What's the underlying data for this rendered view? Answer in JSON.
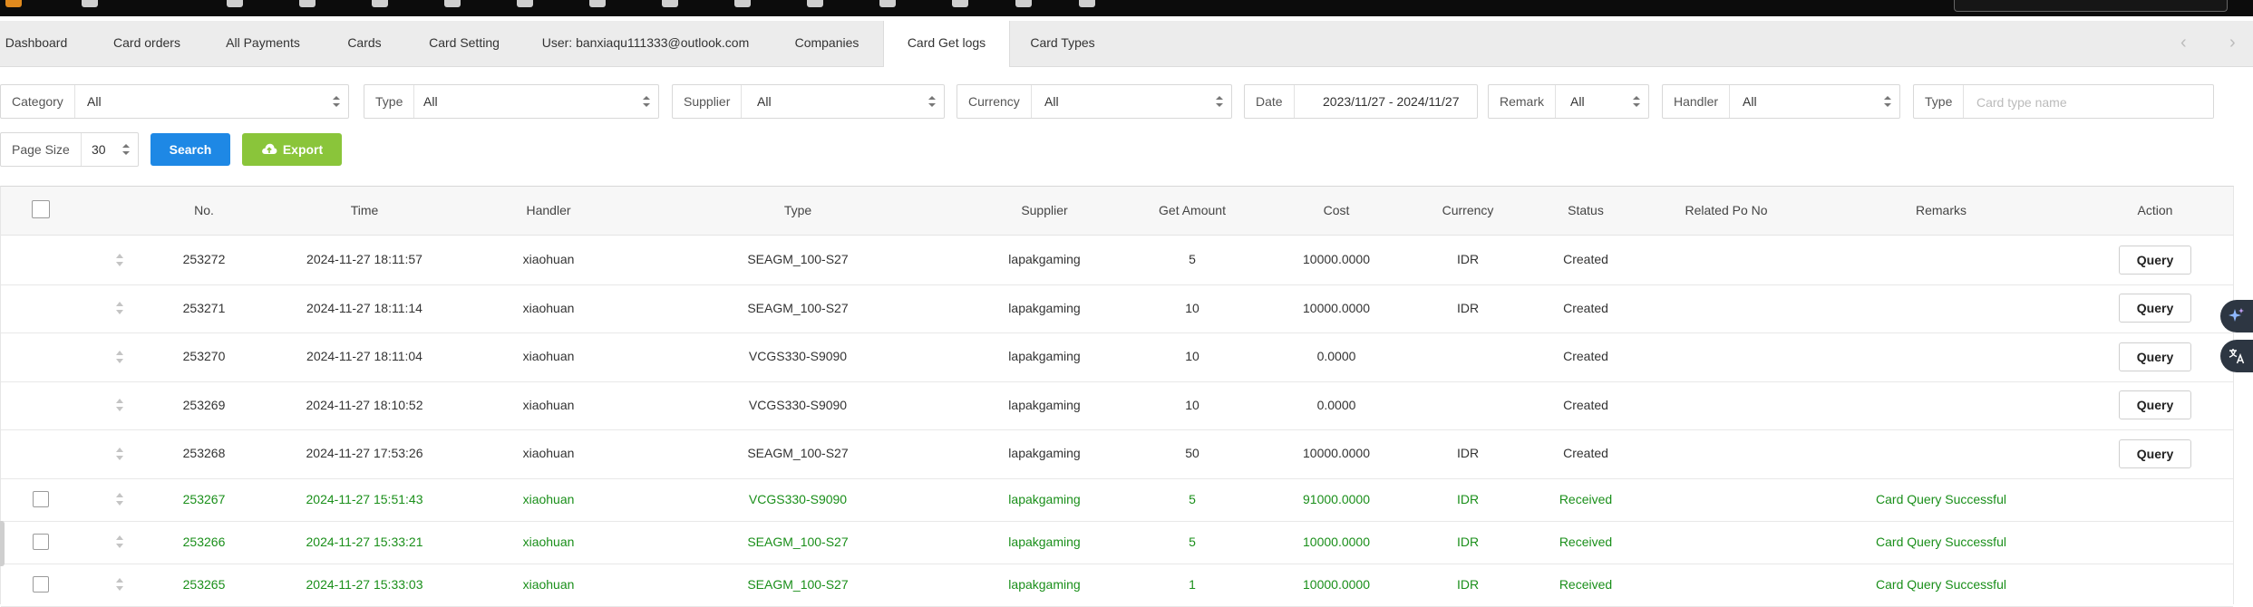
{
  "tabs": [
    {
      "label": "Dashboard",
      "active": false
    },
    {
      "label": "Card orders",
      "active": false
    },
    {
      "label": "All Payments",
      "active": false
    },
    {
      "label": "Cards",
      "active": false
    },
    {
      "label": "Card Setting",
      "active": false
    },
    {
      "label": "User: banxiaqu111333@outlook.com",
      "active": false
    },
    {
      "label": "Companies",
      "active": false
    },
    {
      "label": "Card Get logs",
      "active": true
    },
    {
      "label": "Card Types",
      "active": false
    }
  ],
  "tab_nav": {
    "prev": "‹",
    "next": "›"
  },
  "filters": {
    "category": {
      "label": "Category",
      "value": "All"
    },
    "type": {
      "label": "Type",
      "value": "All"
    },
    "supplier": {
      "label": "Supplier",
      "value": "All"
    },
    "currency": {
      "label": "Currency",
      "value": "All"
    },
    "date": {
      "label": "Date",
      "value": "2023/11/27 - 2024/11/27"
    },
    "remark": {
      "label": "Remark",
      "value": "All"
    },
    "handler": {
      "label": "Handler",
      "value": "All"
    },
    "card_type": {
      "label": "Type",
      "value": "",
      "placeholder": "Card type name"
    },
    "page_size": {
      "label": "Page Size",
      "value": "30"
    }
  },
  "buttons": {
    "search": "Search",
    "export": "Export"
  },
  "table": {
    "columns": [
      "No.",
      "Time",
      "Handler",
      "Type",
      "Supplier",
      "Get Amount",
      "Cost",
      "Currency",
      "Status",
      "Related Po No",
      "Remarks",
      "Action"
    ],
    "rows": [
      {
        "no": "253272",
        "time": "2024-11-27 18:11:57",
        "handler": "xiaohuan",
        "type": "SEAGM_100-S27",
        "supplier": "lapakgaming",
        "amount": "5",
        "cost": "10000.0000",
        "currency": "IDR",
        "status": "Created",
        "po": "",
        "remarks": "",
        "action": "Query",
        "checkbox": false,
        "received": false
      },
      {
        "no": "253271",
        "time": "2024-11-27 18:11:14",
        "handler": "xiaohuan",
        "type": "SEAGM_100-S27",
        "supplier": "lapakgaming",
        "amount": "10",
        "cost": "10000.0000",
        "currency": "IDR",
        "status": "Created",
        "po": "",
        "remarks": "",
        "action": "Query",
        "checkbox": false,
        "received": false
      },
      {
        "no": "253270",
        "time": "2024-11-27 18:11:04",
        "handler": "xiaohuan",
        "type": "VCGS330-S9090",
        "supplier": "lapakgaming",
        "amount": "10",
        "cost": "0.0000",
        "currency": "",
        "status": "Created",
        "po": "",
        "remarks": "",
        "action": "Query",
        "checkbox": false,
        "received": false
      },
      {
        "no": "253269",
        "time": "2024-11-27 18:10:52",
        "handler": "xiaohuan",
        "type": "VCGS330-S9090",
        "supplier": "lapakgaming",
        "amount": "10",
        "cost": "0.0000",
        "currency": "",
        "status": "Created",
        "po": "",
        "remarks": "",
        "action": "Query",
        "checkbox": false,
        "received": false
      },
      {
        "no": "253268",
        "time": "2024-11-27 17:53:26",
        "handler": "xiaohuan",
        "type": "SEAGM_100-S27",
        "supplier": "lapakgaming",
        "amount": "50",
        "cost": "10000.0000",
        "currency": "IDR",
        "status": "Created",
        "po": "",
        "remarks": "",
        "action": "Query",
        "checkbox": false,
        "received": false
      },
      {
        "no": "253267",
        "time": "2024-11-27 15:51:43",
        "handler": "xiaohuan",
        "type": "VCGS330-S9090",
        "supplier": "lapakgaming",
        "amount": "5",
        "cost": "91000.0000",
        "currency": "IDR",
        "status": "Received",
        "po": "",
        "remarks": "Card Query Successful",
        "action": "",
        "checkbox": true,
        "received": true
      },
      {
        "no": "253266",
        "time": "2024-11-27 15:33:21",
        "handler": "xiaohuan",
        "type": "SEAGM_100-S27",
        "supplier": "lapakgaming",
        "amount": "5",
        "cost": "10000.0000",
        "currency": "IDR",
        "status": "Received",
        "po": "",
        "remarks": "Card Query Successful",
        "action": "",
        "checkbox": true,
        "received": true
      },
      {
        "no": "253265",
        "time": "2024-11-27 15:33:03",
        "handler": "xiaohuan",
        "type": "SEAGM_100-S27",
        "supplier": "lapakgaming",
        "amount": "1",
        "cost": "10000.0000",
        "currency": "IDR",
        "status": "Received",
        "po": "",
        "remarks": "Card Query Successful",
        "action": "",
        "checkbox": true,
        "received": true
      }
    ]
  },
  "colors": {
    "primary": "#1e88e5",
    "export": "#8ac53a",
    "received_text": "#1a8f1a",
    "active_tab": "#ffffff",
    "tab_bar": "#ececec"
  },
  "icons": {
    "export": "cloud-upload-icon",
    "sparkle": "sparkle-icon",
    "translate": "translate-icon"
  }
}
